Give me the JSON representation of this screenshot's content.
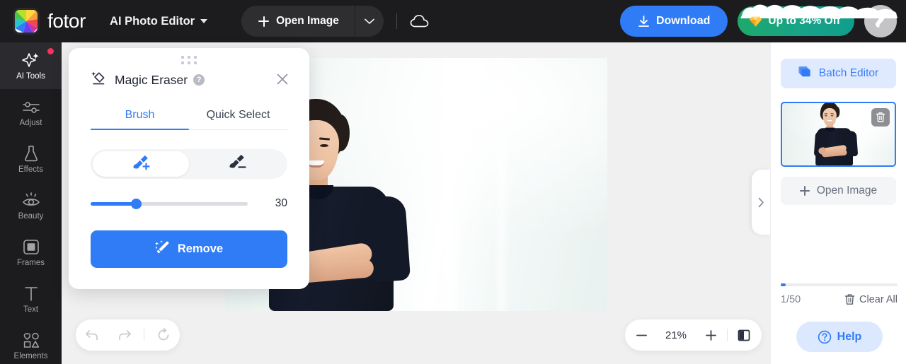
{
  "topbar": {
    "brand": "fotor",
    "brand_icon": "fotor-pinwheel-logo",
    "app_switcher": {
      "label": "AI Photo Editor",
      "icon": "chevron-down-icon"
    },
    "open_image": {
      "label": "Open Image",
      "icon": "plus-icon",
      "caret_icon": "chevron-down-icon"
    },
    "cloud_icon": "cloud-icon",
    "download": {
      "label": "Download",
      "icon": "download-icon"
    },
    "promo": {
      "label": "Up to 34% Off",
      "icon": "gem-icon",
      "color": "#17a37e"
    },
    "avatar": {
      "icon": "bird-avatar-icon",
      "color": "#c4c4c6"
    }
  },
  "sidebar": {
    "items": [
      {
        "label": "AI Tools",
        "icon": "sparkles-icon",
        "active": true,
        "badge": true
      },
      {
        "label": "Adjust",
        "icon": "sliders-icon",
        "active": false,
        "badge": false
      },
      {
        "label": "Effects",
        "icon": "flask-icon",
        "active": false,
        "badge": false
      },
      {
        "label": "Beauty",
        "icon": "eye-icon",
        "active": false,
        "badge": false
      },
      {
        "label": "Frames",
        "icon": "frame-square-icon",
        "active": false,
        "badge": false
      },
      {
        "label": "Text",
        "icon": "text-t-icon",
        "active": false,
        "badge": false
      },
      {
        "label": "Elements",
        "icon": "shapes-icon",
        "active": false,
        "badge": false
      }
    ]
  },
  "tool_panel": {
    "title": "Magic Eraser",
    "title_icon": "magic-eraser-icon",
    "help_badge": "?",
    "close_icon": "close-icon",
    "drag_handle_icon": "drag-dots-icon",
    "tabs": [
      {
        "label": "Brush",
        "active": true
      },
      {
        "label": "Quick Select",
        "active": false
      }
    ],
    "brush_modes": [
      {
        "icon": "brush-add-icon",
        "active": true
      },
      {
        "icon": "brush-erase-icon",
        "active": false
      }
    ],
    "brush_size": {
      "value": "30",
      "percent": 29,
      "min": 1,
      "max": 100
    },
    "remove_button": {
      "label": "Remove",
      "icon": "magic-wand-icon",
      "color": "#2f7cf6"
    }
  },
  "canvas": {
    "collapse_handle_icon": "chevron-right-icon",
    "history": {
      "undo_icon": "undo-arrow-icon",
      "redo_icon": "redo-arrow-icon",
      "reset_icon": "reset-circle-icon"
    },
    "zoom": {
      "minus_icon": "minus-icon",
      "level": "21%",
      "plus_icon": "plus-icon",
      "compare_icon": "compare-split-icon"
    }
  },
  "right_panel": {
    "batch_editor": {
      "label": "Batch Editor",
      "icon": "layers-stack-icon"
    },
    "thumbnail": {
      "delete_icon": "trash-icon",
      "selected": true
    },
    "open_image": {
      "label": "Open Image",
      "icon": "plus-icon"
    },
    "count": "1/50",
    "clear_all": {
      "label": "Clear All",
      "icon": "trash-icon"
    },
    "help": {
      "label": "Help",
      "icon": "question-circle-icon"
    },
    "scroll_percent": 4
  }
}
